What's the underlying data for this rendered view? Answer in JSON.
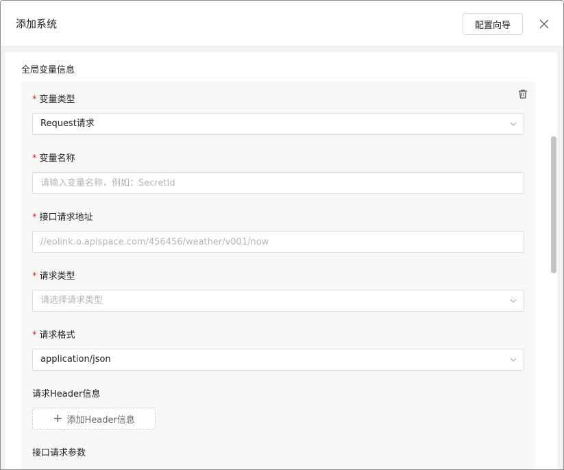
{
  "dialog": {
    "title": "添加系统",
    "wizard_button": "配置向导"
  },
  "section": {
    "title": "全局变量信息"
  },
  "fields": {
    "var_type": {
      "label": "变量类型",
      "value": "Request请求"
    },
    "var_name": {
      "label": "变量名称",
      "placeholder": "请输入变量名称，例如：SecretId"
    },
    "api_url": {
      "label": "接口请求地址",
      "placeholder": "//eolink.o.apispace.com/456456/weather/v001/now"
    },
    "req_type": {
      "label": "请求类型",
      "placeholder": "请选择请求类型"
    },
    "req_format": {
      "label": "请求格式",
      "value": "application/json"
    }
  },
  "header_info": {
    "label": "请求Header信息",
    "add_button": "添加Header信息"
  },
  "params": {
    "label": "接口请求参数"
  },
  "required_mark": "*",
  "icons": {
    "close": "close-icon",
    "trash": "trash-icon",
    "chevron": "chevron-down-icon",
    "plus": "plus-icon"
  },
  "colors": {
    "required": "#e02020",
    "placeholder": "#b5b5b5",
    "card_bg": "#f8f8f8"
  }
}
